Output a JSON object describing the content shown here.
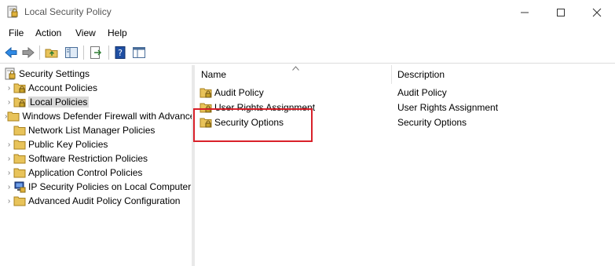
{
  "window": {
    "title": "Local Security Policy"
  },
  "menubar": {
    "items": [
      "File",
      "Action",
      "View",
      "Help"
    ]
  },
  "tree": {
    "root": "Security Settings",
    "items": [
      {
        "label": "Account Policies",
        "icon": "folder-lock-icon"
      },
      {
        "label": "Local Policies",
        "icon": "folder-lock-icon",
        "selected": true
      },
      {
        "label": "Windows Defender Firewall with Advanced Security",
        "icon": "folder-icon"
      },
      {
        "label": "Network List Manager Policies",
        "icon": "folder-icon"
      },
      {
        "label": "Public Key Policies",
        "icon": "folder-icon"
      },
      {
        "label": "Software Restriction Policies",
        "icon": "folder-icon"
      },
      {
        "label": "Application Control Policies",
        "icon": "folder-icon"
      },
      {
        "label": "IP Security Policies on Local Computer",
        "icon": "ip-security-icon"
      },
      {
        "label": "Advanced Audit Policy Configuration",
        "icon": "folder-icon"
      }
    ]
  },
  "list": {
    "headers": {
      "name": "Name",
      "description": "Description"
    },
    "rows": [
      {
        "name": "Audit Policy",
        "description": "Audit Policy"
      },
      {
        "name": "User Rights Assignment",
        "description": "User Rights Assignment"
      },
      {
        "name": "Security Options",
        "description": "Security Options"
      }
    ]
  },
  "colors": {
    "annotation_border": "#d9212a",
    "selection_bg": "#d9d9d9",
    "folder": "#e8c35a"
  }
}
